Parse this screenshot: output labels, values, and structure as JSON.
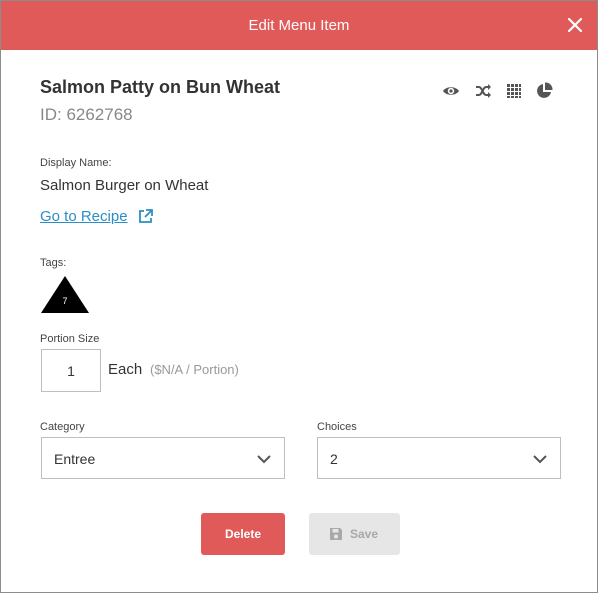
{
  "dialog": {
    "title": "Edit Menu Item",
    "close_label": "×"
  },
  "item": {
    "name": "Salmon Patty on Bun Wheat",
    "id_text": "ID: 6262768"
  },
  "toolbar": {
    "icons": [
      "eye-icon",
      "shuffle-icon",
      "grid-icon",
      "pie-chart-icon"
    ]
  },
  "display_name": {
    "label": "Display Name:",
    "value": "Salmon Burger on Wheat"
  },
  "recipe_link": {
    "label": "Go to Recipe"
  },
  "tags": {
    "label": "Tags:",
    "count": "7"
  },
  "portion": {
    "label": "Portion Size",
    "value": "1",
    "unit": "Each",
    "cost": "($N/A / Portion)"
  },
  "category": {
    "label": "Category",
    "selected": "Entree"
  },
  "choices": {
    "label": "Choices",
    "selected": "2"
  },
  "actions": {
    "delete_label": "Delete",
    "save_label": "Save"
  },
  "colors": {
    "header": "#e15a5a",
    "link": "#2b8fc4",
    "delete": "#e15a5a",
    "save_disabled": "#e6e6e6"
  }
}
